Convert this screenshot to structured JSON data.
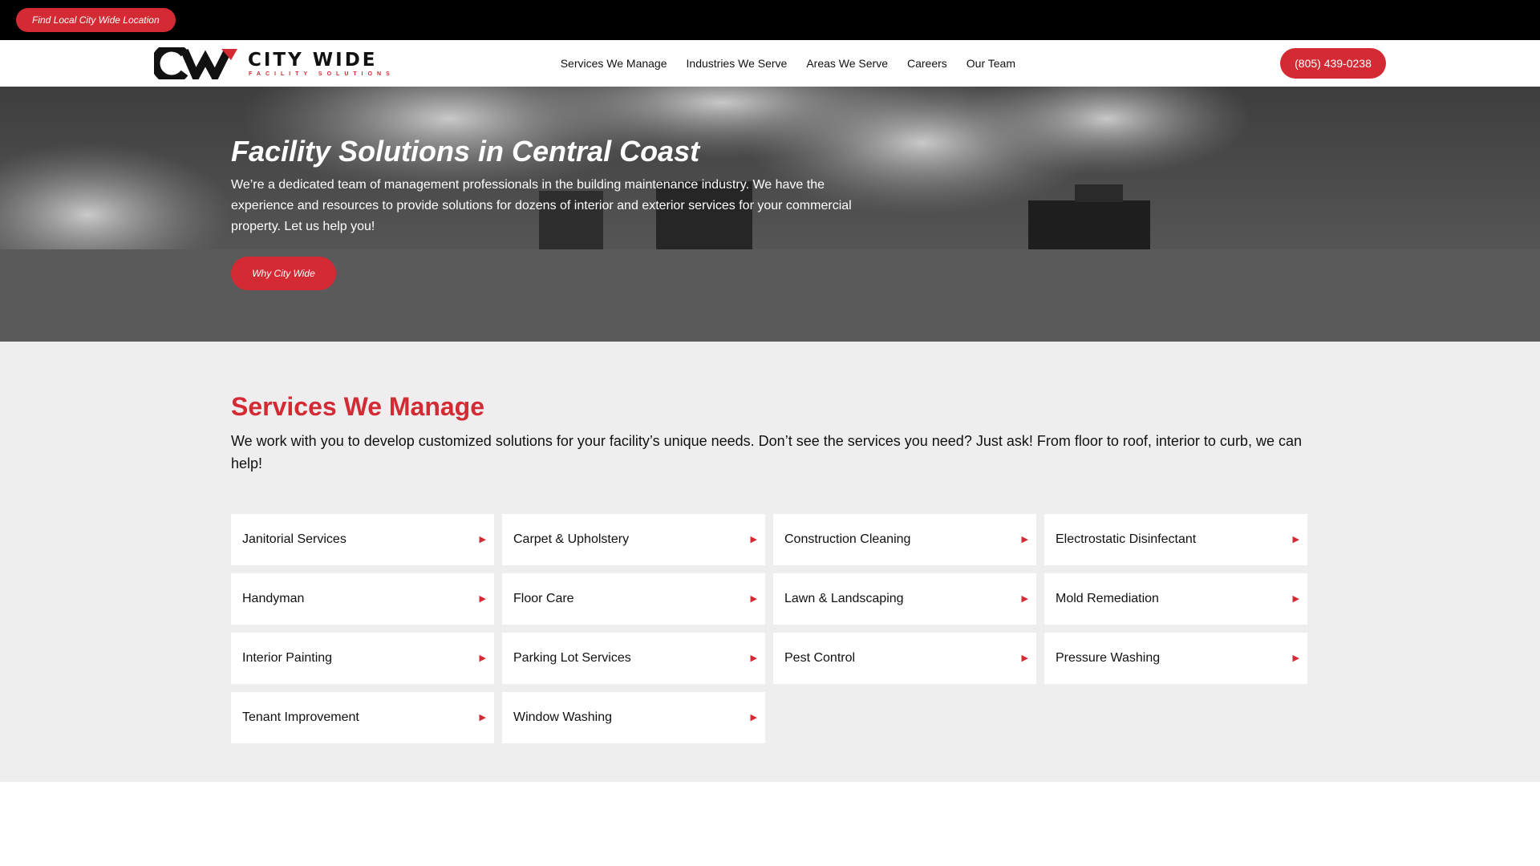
{
  "topbar": {
    "locator_label": "Find Local City Wide Location"
  },
  "header": {
    "logo": {
      "name": "CITY WIDE",
      "tagline": "FACILITY SOLUTIONS",
      "colors": {
        "dark": "#111111",
        "accent": "#d42a33"
      }
    },
    "nav": [
      "Services We Manage",
      "Industries We Serve",
      "Areas We Serve",
      "Careers",
      "Our Team"
    ],
    "phone": "(805) 439-0238"
  },
  "hero": {
    "title": "Facility Solutions in Central Coast",
    "text": "We’re a dedicated team of management professionals in the building maintenance industry. We have the experience and resources to provide solutions for dozens of interior and exterior services for your commercial property. Let us help you!",
    "cta": "Why City Wide"
  },
  "services": {
    "title": "Services We Manage",
    "text": "We work with you to develop customized solutions for your facility’s unique needs. Don’t see the services you need? Just ask! From floor to roof, interior to curb, we can help!",
    "items": [
      "Janitorial Services",
      "Carpet & Upholstery",
      "Construction Cleaning",
      "Electrostatic Disinfectant",
      "Handyman",
      "Floor Care",
      "Lawn & Landscaping",
      "Mold Remediation",
      "Interior Painting",
      "Parking Lot Services",
      "Pest Control",
      "Pressure Washing",
      "Tenant Improvement",
      "Window Washing"
    ],
    "arrow_icon": "triangle-right-icon"
  },
  "colors": {
    "accent": "#d42a33",
    "topbar": "#000000",
    "hero_band": "#5a5a5a",
    "section_bg": "#eeeeee"
  }
}
